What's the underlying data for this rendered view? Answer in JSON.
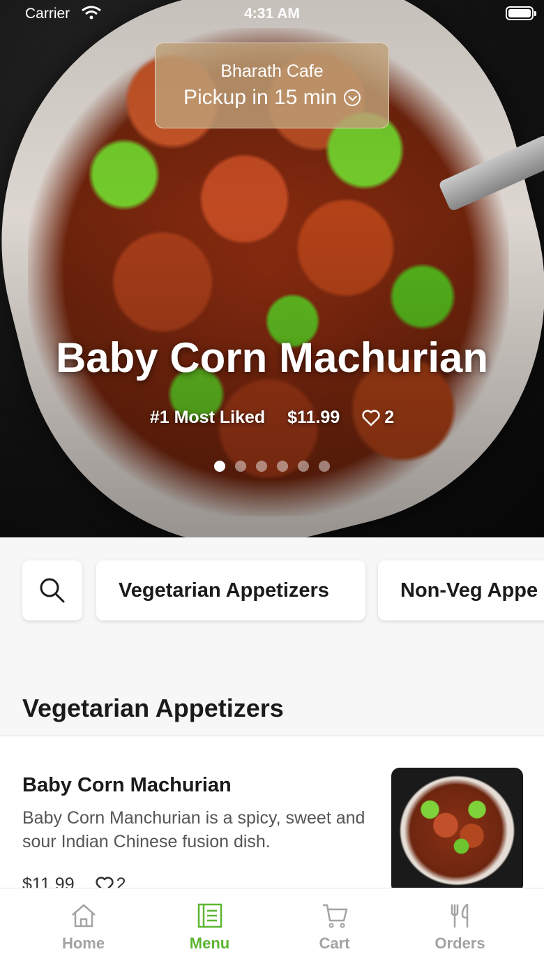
{
  "status_bar": {
    "carrier": "Carrier",
    "time": "4:31 AM"
  },
  "pickup": {
    "cafe_name": "Bharath Cafe",
    "pickup_text": "Pickup in 15 min"
  },
  "hero": {
    "title": "Baby Corn Machurian",
    "badge": "#1 Most Liked",
    "price": "$11.99",
    "likes": "2",
    "slide_count": 6,
    "active_slide": 0
  },
  "categories": {
    "search_icon": "search-icon",
    "items": [
      "Vegetarian Appetizers",
      "Non-Veg Appe"
    ]
  },
  "section": {
    "title": "Vegetarian Appetizers",
    "items": [
      {
        "name": "Baby Corn Machurian",
        "description": "Baby Corn Manchurian is a spicy, sweet and sour Indian Chinese fusion dish.",
        "price": "$11.99",
        "likes": "2"
      }
    ]
  },
  "tabbar": {
    "active": "Menu",
    "accent_color": "#5cb531",
    "tabs": [
      {
        "label": "Home",
        "icon": "home-icon"
      },
      {
        "label": "Menu",
        "icon": "menu-icon"
      },
      {
        "label": "Cart",
        "icon": "cart-icon"
      },
      {
        "label": "Orders",
        "icon": "utensils-icon"
      }
    ]
  }
}
